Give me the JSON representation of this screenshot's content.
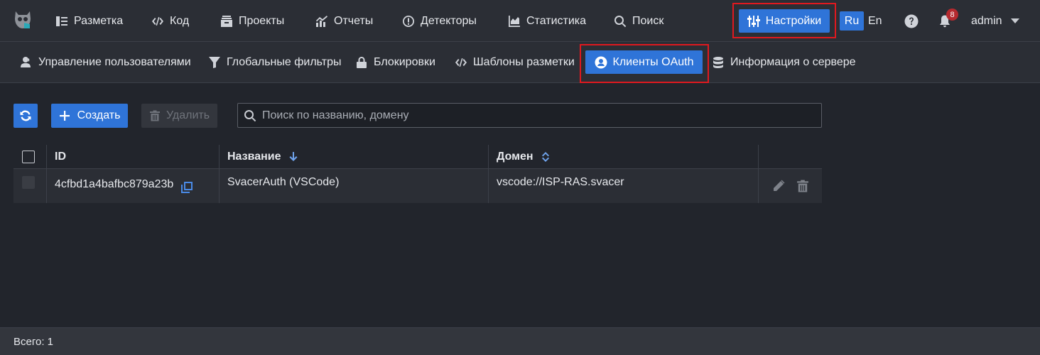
{
  "topnav": {
    "items": [
      {
        "label": "Разметка",
        "icon": "markup-icon"
      },
      {
        "label": "Код",
        "icon": "code-icon"
      },
      {
        "label": "Проекты",
        "icon": "projects-icon"
      },
      {
        "label": "Отчеты",
        "icon": "reports-icon"
      },
      {
        "label": "Детекторы",
        "icon": "detectors-icon"
      },
      {
        "label": "Статистика",
        "icon": "statistics-icon"
      },
      {
        "label": "Поиск",
        "icon": "search-icon"
      }
    ],
    "settings_label": "Настройки",
    "lang_ru": "Ru",
    "lang_en": "En",
    "notification_count": "8",
    "user": "admin"
  },
  "subnav": {
    "items": [
      {
        "label": "Управление пользователями",
        "icon": "users-icon"
      },
      {
        "label": "Глобальные фильтры",
        "icon": "filter-icon"
      },
      {
        "label": "Блокировки",
        "icon": "lock-icon"
      },
      {
        "label": "Шаблоны разметки",
        "icon": "code-icon"
      },
      {
        "label": "Клиенты OAuth",
        "icon": "user-circle-icon"
      },
      {
        "label": "Информация о сервере",
        "icon": "database-icon"
      }
    ]
  },
  "toolbar": {
    "create_label": "Создать",
    "delete_label": "Удалить",
    "search_placeholder": "Поиск по названию, домену"
  },
  "table": {
    "columns": [
      "ID",
      "Название",
      "Домен"
    ],
    "rows": [
      {
        "id": "4cfbd1a4bafbc879a23b",
        "name": "SvacerAuth (VSCode)",
        "domain": "vscode://ISP-RAS.svacer"
      }
    ]
  },
  "footer": {
    "total": "Всего: 1"
  },
  "colors": {
    "accent": "#2f74d8",
    "highlight_frame": "#e0191f",
    "badge": "#b52a2f"
  }
}
